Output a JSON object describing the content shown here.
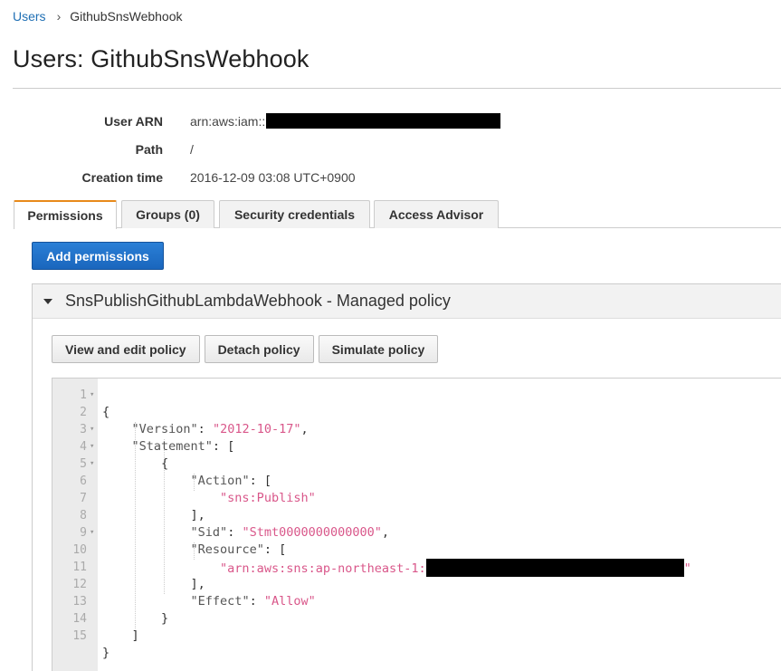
{
  "breadcrumb": {
    "parent": "Users",
    "current": "GithubSnsWebhook"
  },
  "page_title": "Users: GithubSnsWebhook",
  "summary": {
    "arn_label": "User ARN",
    "arn_value": "arn:aws:iam::",
    "path_label": "Path",
    "path_value": "/",
    "created_label": "Creation time",
    "created_value": "2016-12-09 03:08 UTC+0900"
  },
  "tabs": [
    "Permissions",
    "Groups (0)",
    "Security credentials",
    "Access Advisor"
  ],
  "add_permissions_label": "Add permissions",
  "policy": {
    "title": "SnsPublishGithubLambdaWebhook - Managed policy",
    "buttons": [
      "View and edit policy",
      "Detach policy",
      "Simulate policy"
    ]
  },
  "editor": {
    "lines": [
      {
        "n": "1",
        "fold": true
      },
      {
        "n": "2",
        "fold": false
      },
      {
        "n": "3",
        "fold": true
      },
      {
        "n": "4",
        "fold": true
      },
      {
        "n": "5",
        "fold": true
      },
      {
        "n": "6",
        "fold": false
      },
      {
        "n": "7",
        "fold": false
      },
      {
        "n": "8",
        "fold": false
      },
      {
        "n": "9",
        "fold": true
      },
      {
        "n": "10",
        "fold": false
      },
      {
        "n": "11",
        "fold": false
      },
      {
        "n": "12",
        "fold": false
      },
      {
        "n": "13",
        "fold": false
      },
      {
        "n": "14",
        "fold": false
      },
      {
        "n": "15",
        "fold": false
      }
    ],
    "json": {
      "open": "{",
      "version_key": "\"Version\"",
      "version_val": "\"2012-10-17\"",
      "statement_key": "\"Statement\"",
      "stmt_open": "{",
      "action_key": "\"Action\"",
      "action_val": "\"sns:Publish\"",
      "sid_key": "\"Sid\"",
      "sid_val": "\"Stmt0000000000000\"",
      "resource_key": "\"Resource\"",
      "resource_val": "\"arn:aws:sns:ap-northeast-1:",
      "resource_end": "\"",
      "effect_key": "\"Effect\"",
      "effect_val": "\"Allow\"",
      "stmt_close": "}",
      "arr_close": "]",
      "close": "}"
    }
  },
  "colors": {
    "accent_tab": "#e88a1a",
    "primary_button": "#1a66bd",
    "link": "#1f6fb4",
    "json_string": "#d9578a"
  },
  "icons": {
    "breadcrumb_separator": "chevron-right-icon",
    "collapse": "caret-down-icon",
    "fold_marker": "fold-caret-icon"
  }
}
